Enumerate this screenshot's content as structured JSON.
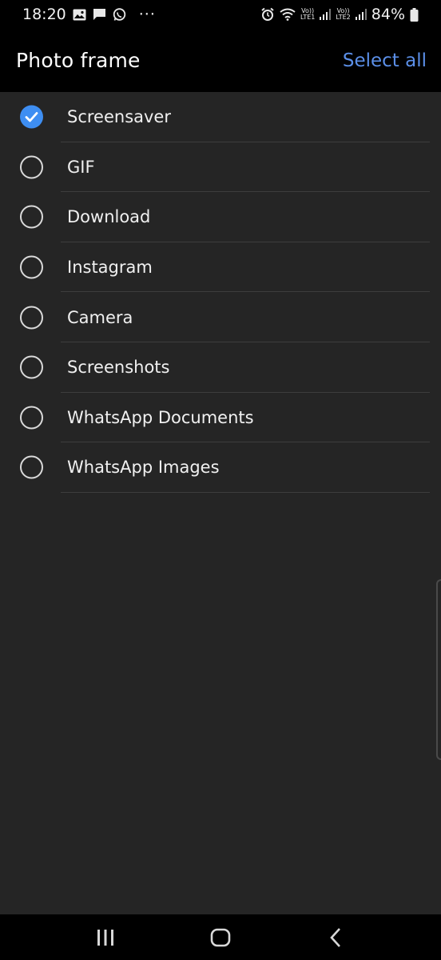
{
  "status_bar": {
    "time": "18:20",
    "more": "···",
    "sim1_top": "Vo))",
    "sim1_bottom": "LTE1",
    "sim2_top": "Vo))",
    "sim2_bottom": "LTE2",
    "battery": "84%",
    "icons_left": [
      "gallery-icon",
      "message-icon",
      "whatsapp-icon"
    ],
    "icons_right": [
      "alarm-icon",
      "wifi-icon",
      "signal-icon",
      "battery-icon"
    ]
  },
  "header": {
    "title": "Photo frame",
    "select_all": "Select all"
  },
  "albums": [
    {
      "label": "Screensaver",
      "checked": true
    },
    {
      "label": "GIF",
      "checked": false
    },
    {
      "label": "Download",
      "checked": false
    },
    {
      "label": "Instagram",
      "checked": false
    },
    {
      "label": "Camera",
      "checked": false
    },
    {
      "label": "Screenshots",
      "checked": false
    },
    {
      "label": "WhatsApp Documents",
      "checked": false
    },
    {
      "label": "WhatsApp Images",
      "checked": false
    }
  ],
  "nav": {
    "buttons": [
      "recents-icon",
      "home-icon",
      "back-icon"
    ]
  },
  "colors": {
    "accent": "#5b8fe8",
    "checked": "#3e8ef2",
    "background": "#252525",
    "bar": "#000000"
  }
}
